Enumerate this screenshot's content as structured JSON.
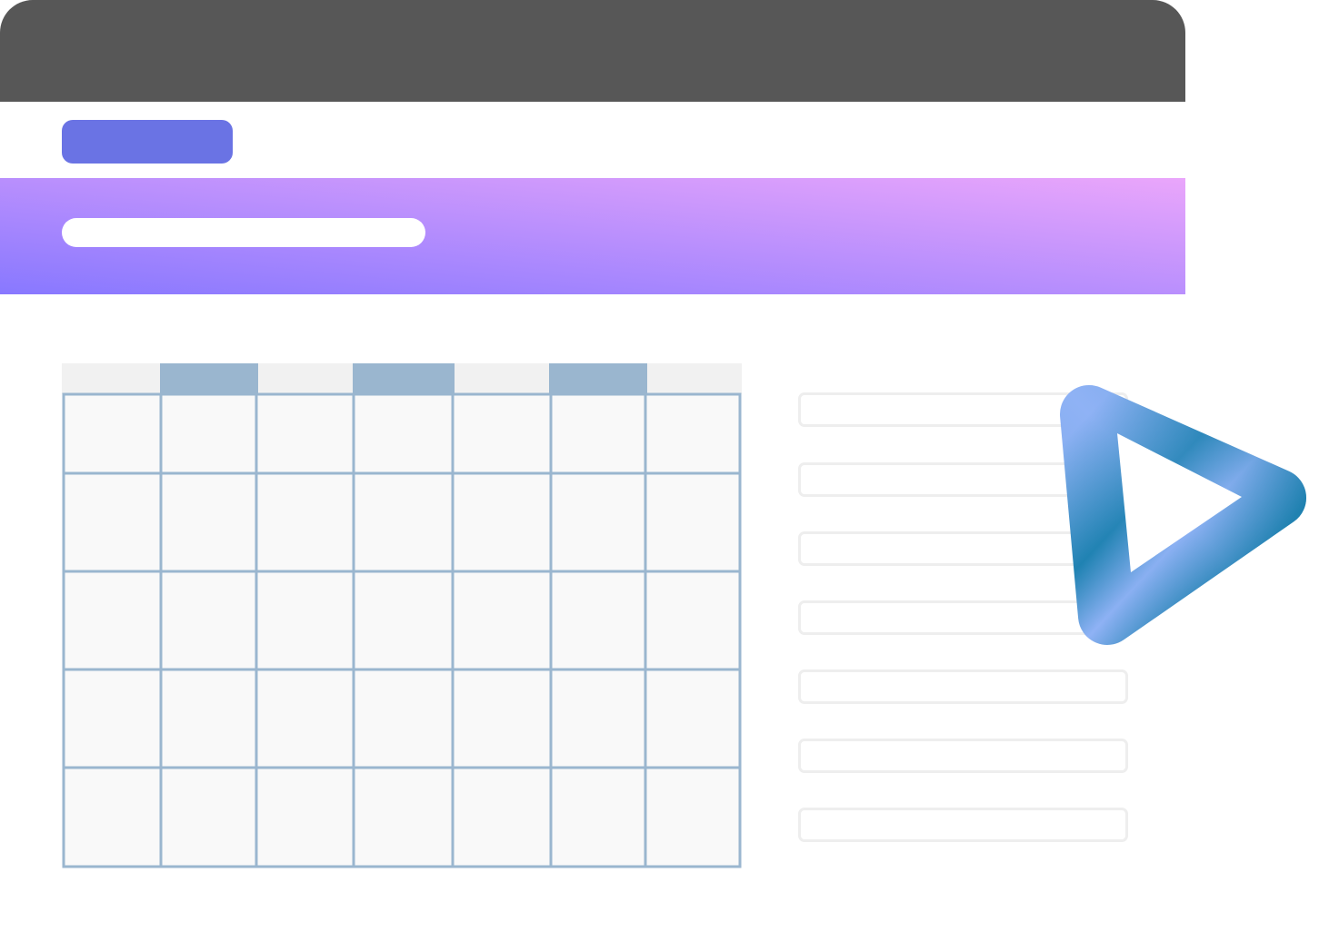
{
  "colors": {
    "titlebar": "#575757",
    "accent_button": "#6a73e4",
    "banner_gradient_start": "#8878ff",
    "banner_gradient_end": "#eaa6fb",
    "calendar_grid": "#9ab6cf",
    "calendar_cell": "#f9f9f9",
    "calendar_header_plain": "#f1f1f1",
    "calendar_header_highlight": "#9ab6cf",
    "list_row_border": "#eeeeee",
    "logo_dark": "#0f7aa6",
    "logo_light": "#8fb2f5"
  },
  "icons": {
    "logo": "play-triangle-icon"
  },
  "calendar": {
    "header_highlight_pattern": [
      false,
      true,
      false,
      true,
      false,
      true,
      false
    ]
  }
}
